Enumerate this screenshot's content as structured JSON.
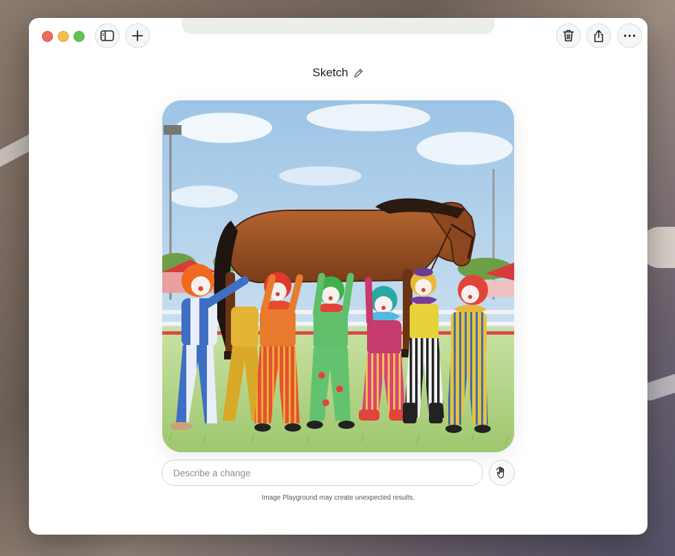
{
  "window": {
    "title": "Sketch",
    "traffic_lights": {
      "close": "#ed6a5e",
      "minimize": "#f5bf4f",
      "maximize": "#61c554"
    }
  },
  "toolbar": {
    "left": [
      {
        "name": "sidebar-toggle-button",
        "icon": "sidebar-icon"
      },
      {
        "name": "new-image-button",
        "icon": "plus-icon"
      }
    ],
    "right": [
      {
        "name": "delete-button",
        "icon": "trash-icon"
      },
      {
        "name": "share-button",
        "icon": "share-icon"
      },
      {
        "name": "more-button",
        "icon": "ellipsis-icon"
      }
    ]
  },
  "image": {
    "style": "Sketch",
    "subject": "horse-lifted-by-clowns"
  },
  "prompt": {
    "placeholder": "Describe a change",
    "value": ""
  },
  "disclaimer": "Image Playground may create unexpected results.",
  "colors": {
    "accent_text": "#1d1d1f",
    "border": "#d3d3d3"
  }
}
